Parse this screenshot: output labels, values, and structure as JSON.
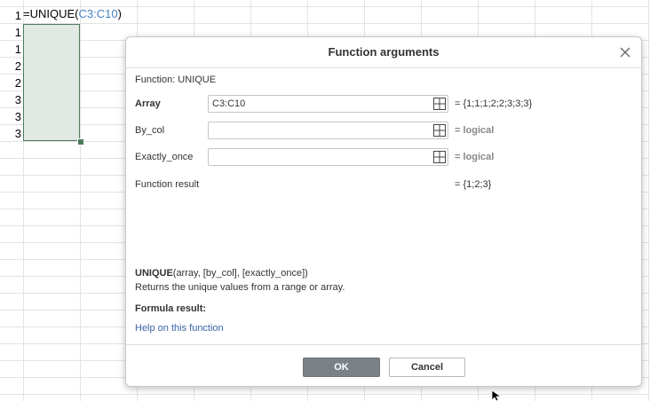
{
  "sheet": {
    "formula_prefix": "=UNIQUE(",
    "formula_ref": "C3:C10",
    "formula_suffix": ")",
    "row_values": [
      "1",
      "1",
      "1",
      "2",
      "2",
      "3",
      "3",
      "3"
    ]
  },
  "dialog": {
    "title": "Function arguments",
    "function_line": "Function: UNIQUE",
    "args": [
      {
        "label": "Array",
        "value": "C3:C10",
        "result": "= {1;1;1;2;2;3;3;3}"
      },
      {
        "label": "By_col",
        "value": "",
        "result": "= logical"
      },
      {
        "label": "Exactly_once",
        "value": "",
        "result": "= logical"
      }
    ],
    "function_result_label": "Function result",
    "function_result_value": "= {1;2;3}",
    "signature_name": "UNIQUE",
    "signature_args": "(array, [by_col], [exactly_once])",
    "description": "Returns the unique values from a range or array.",
    "formula_result_label": "Formula result:",
    "help_link": "Help on this function",
    "ok_label": "OK",
    "cancel_label": "Cancel"
  },
  "colors": {
    "selection_fill": "#e2e8e3",
    "selection_border": "#4d7a5c",
    "ok_button": "#7a8288",
    "link": "#3a64a8",
    "formula_ref": "#4a7fc1"
  }
}
